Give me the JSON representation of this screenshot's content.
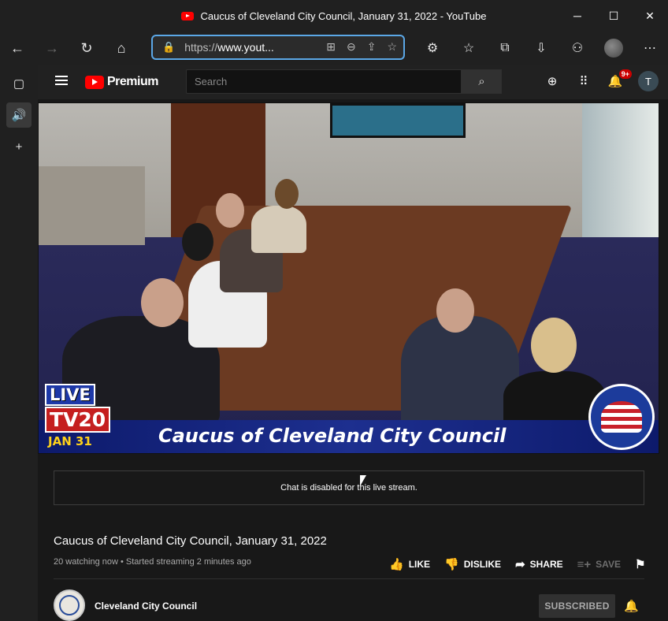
{
  "window": {
    "title": "Caucus of Cleveland City Council, January 31, 2022 - YouTube",
    "minimize": "─",
    "maximize": "☐",
    "close": "✕"
  },
  "browser": {
    "url_prefix": "https://",
    "url_domain": "www.yout...",
    "back_icon": "←",
    "forward_icon": "→",
    "reload_icon": "↻",
    "home_icon": "⌂",
    "lock_icon": "🔒",
    "url_icons": [
      "⊞",
      "⊖",
      "⇪",
      "☆"
    ],
    "toolbar_icons": [
      "⚙",
      "☆",
      "⧉",
      "⇩",
      "⚇"
    ],
    "more_icon": "⋯"
  },
  "sidebar": {
    "tabs_icon": "▢",
    "audio_icon": "🔊",
    "add_icon": "+"
  },
  "youtube": {
    "logo_text": "Premium",
    "search_placeholder": "Search",
    "search_icon": "⌕",
    "create_icon": "⊕",
    "apps_icon": "⠿",
    "bell_icon": "🔔",
    "notification_count": "9+",
    "user_initial": "T"
  },
  "video": {
    "lower_third_title": "Caucus of Cleveland City Council",
    "live_label": "LIVE",
    "channel_label": "TV20",
    "date_label": "JAN 31"
  },
  "chat": {
    "message": "Chat is disabled for this live stream."
  },
  "details": {
    "title": "Caucus of Cleveland City Council, January 31, 2022",
    "meta": "20 watching now • Started streaming 2 minutes ago",
    "like": "LIKE",
    "dislike": "DISLIKE",
    "share": "SHARE",
    "save": "SAVE",
    "like_icon": "👍",
    "dislike_icon": "👎",
    "share_icon": "➦",
    "save_icon": "≡+",
    "flag_icon": "⚑"
  },
  "channel": {
    "name": "Cleveland City Council",
    "subscribe_label": "SUBSCRIBED",
    "bell_icon": "🔔"
  }
}
